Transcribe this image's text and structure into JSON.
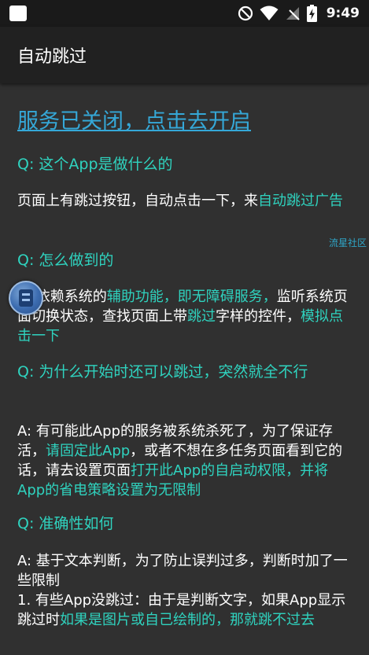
{
  "status_bar": {
    "time": "9:49",
    "icons": [
      "app-notification-icon",
      "do-not-disturb-icon",
      "wifi-icon",
      "no-signal-icon",
      "battery-charging-icon"
    ]
  },
  "app_bar": {
    "title": "自动跳过"
  },
  "service_link": "服务已关闭，点击去开启",
  "faq": [
    {
      "question": "Q: 这个App是做什么的",
      "answer_parts": [
        {
          "text": "页面上有跳过按钮，自动点击一下，来"
        },
        {
          "text": "自动跳过广告",
          "highlight": true
        }
      ]
    },
    {
      "question": "Q: 怎么做到的",
      "answer_parts": [
        {
          "text": "A: 依赖系统的"
        },
        {
          "text": "辅助功能，即无障碍服务，",
          "highlight": true
        },
        {
          "text": "监听系统页面切换状态，查找页面上带"
        },
        {
          "text": "跳过",
          "highlight": true
        },
        {
          "text": "字样的控件，"
        },
        {
          "text": "模拟点击一下",
          "highlight": true
        }
      ]
    },
    {
      "question": "Q: 为什么开始时还可以跳过，突然就全不行",
      "answer_parts": [
        {
          "text": "A: 有可能此App的服务被系统杀死了，为了保证存活，"
        },
        {
          "text": "请固定此App",
          "highlight": true
        },
        {
          "text": "，或者不想在多任务页面看到它的话，请去设置页面"
        },
        {
          "text": "打开此App的自启动权限，并将App的省电策略设置为无限制",
          "highlight": true
        }
      ]
    },
    {
      "question": "Q: 准确性如何",
      "answer_parts": [
        {
          "text": "A: 基于文本判断，为了防止误判过多，判断时加了一些限制"
        },
        {
          "text": "\n 1. 有些App没跳过：由于是判断文字，如果App显示跳过时"
        },
        {
          "text": "如果是图片或自己绘制的，那就跳不过去",
          "highlight": true
        }
      ]
    }
  ],
  "watermark": "流星社区",
  "colors": {
    "background": "#303030",
    "app_bar": "#212121",
    "accent": "#2fd3bf",
    "link": "#35a8d8"
  }
}
